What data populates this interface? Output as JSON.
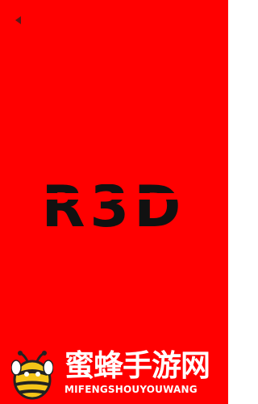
{
  "colors": {
    "background": "#ff0000",
    "title": "#111111",
    "watermark_text": "#ffffff",
    "bee_yellow": "#f5c518",
    "bee_dark": "#222222"
  },
  "back_button": {
    "icon": "back-triangle-icon"
  },
  "title": {
    "text": "R3D"
  },
  "watermark": {
    "icon": "bee-logo-icon",
    "chinese": "蜜蜂手游网",
    "english": "MIFENGSHOUYOUWANG"
  }
}
